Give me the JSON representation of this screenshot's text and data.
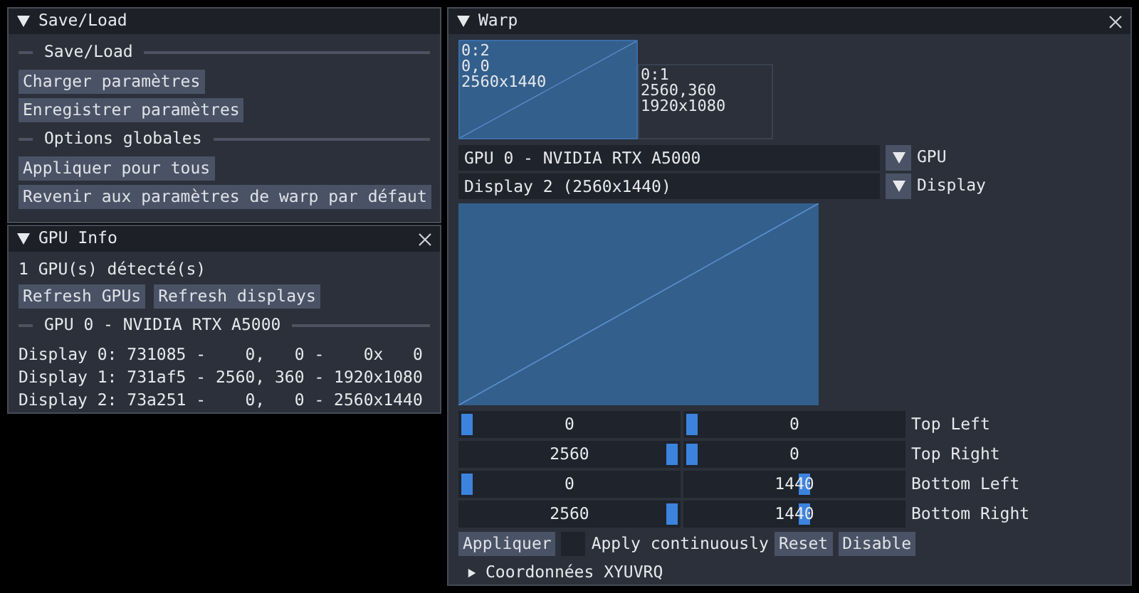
{
  "save_load": {
    "title": "Save/Load",
    "sections": [
      {
        "header": "Save/Load",
        "buttons": [
          "Charger paramètres",
          "Enregistrer paramètres"
        ]
      },
      {
        "header": "Options globales",
        "buttons": [
          "Appliquer pour tous",
          "Revenir aux paramètres de warp par défaut"
        ]
      }
    ]
  },
  "gpu_info": {
    "title": "GPU Info",
    "summary": "1 GPU(s) détecté(s)",
    "buttons": [
      "Refresh GPUs",
      "Refresh displays"
    ],
    "gpus": [
      {
        "header": "GPU 0 - NVIDIA RTX A5000",
        "lines": [
          "Display 0: 731085 -    0,   0 -    0x   0",
          "Display 1: 731af5 - 2560, 360 - 1920x1080",
          "Display 2: 73a251 -    0,   0 - 2560x1440"
        ]
      }
    ]
  },
  "warp": {
    "title": "Warp",
    "displays": [
      {
        "lines": [
          "0:2",
          "0,0",
          "2560x1440"
        ],
        "selected": true
      },
      {
        "lines": [
          "0:1",
          "2560,360",
          "1920x1080"
        ],
        "selected": false
      }
    ],
    "combos": [
      {
        "value": "GPU 0 - NVIDIA RTX A5000",
        "label": "GPU"
      },
      {
        "value": "Display 2 (2560x1440)",
        "label": "Display"
      }
    ],
    "corners": [
      {
        "label": "Top Left",
        "x": {
          "value": "0",
          "level": 0
        },
        "y": {
          "value": "0",
          "level": 0
        }
      },
      {
        "label": "Top Right",
        "x": {
          "value": "2560",
          "level": 1
        },
        "y": {
          "value": "0",
          "level": 0
        }
      },
      {
        "label": "Bottom Left",
        "x": {
          "value": "0",
          "level": 0
        },
        "y": {
          "value": "1440",
          "level": 0.55
        }
      },
      {
        "label": "Bottom Right",
        "x": {
          "value": "2560",
          "level": 1
        },
        "y": {
          "value": "1440",
          "level": 0.55
        }
      }
    ],
    "controls": [
      {
        "kind": "button",
        "label": "Appliquer"
      },
      {
        "kind": "checkbox",
        "label": "Apply continuously",
        "checked": false
      },
      {
        "kind": "button",
        "label": "Reset"
      },
      {
        "kind": "button",
        "label": "Disable"
      }
    ],
    "tree": {
      "label": "Coordonnées XYUVRQ",
      "expanded": false
    }
  }
}
